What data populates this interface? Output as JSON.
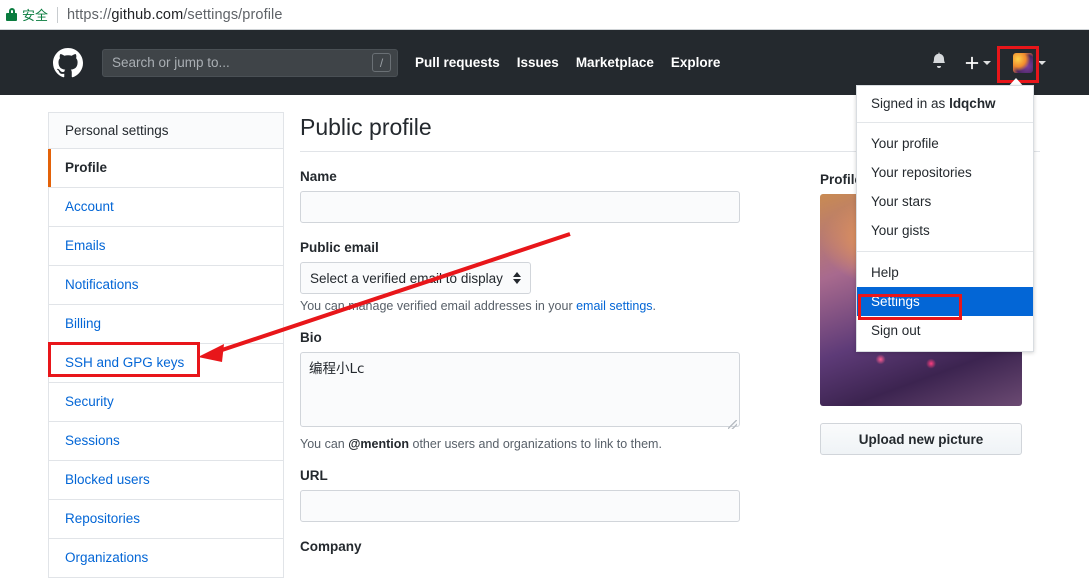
{
  "browser": {
    "secure_label": "安全",
    "url_scheme": "https://",
    "url_host": "github.com",
    "url_path": "/settings/profile"
  },
  "header": {
    "search_placeholder": "Search or jump to...",
    "search_shortcut": "/",
    "nav": [
      {
        "label": "Pull requests"
      },
      {
        "label": "Issues"
      },
      {
        "label": "Marketplace"
      },
      {
        "label": "Explore"
      }
    ]
  },
  "dropdown": {
    "signed_in_prefix": "Signed in as ",
    "username": "ldqchw",
    "group1": [
      {
        "label": "Your profile"
      },
      {
        "label": "Your repositories"
      },
      {
        "label": "Your stars"
      },
      {
        "label": "Your gists"
      }
    ],
    "group2": [
      {
        "label": "Help"
      },
      {
        "label": "Settings",
        "selected": true
      },
      {
        "label": "Sign out"
      }
    ]
  },
  "sidebar": {
    "heading": "Personal settings",
    "items": [
      {
        "label": "Profile",
        "active": true
      },
      {
        "label": "Account"
      },
      {
        "label": "Emails"
      },
      {
        "label": "Notifications"
      },
      {
        "label": "Billing"
      },
      {
        "label": "SSH and GPG keys"
      },
      {
        "label": "Security"
      },
      {
        "label": "Sessions"
      },
      {
        "label": "Blocked users"
      },
      {
        "label": "Repositories"
      },
      {
        "label": "Organizations"
      }
    ]
  },
  "main": {
    "title": "Public profile",
    "name_label": "Name",
    "name_value": "",
    "public_email_label": "Public email",
    "public_email_selected": "Select a verified email to display",
    "email_help_prefix": "You can manage verified email addresses in your ",
    "email_help_link": "email settings",
    "email_help_suffix": ".",
    "bio_label": "Bio",
    "bio_value": "编程小Lc",
    "bio_help_prefix": "You can ",
    "bio_help_mention": "@mention",
    "bio_help_suffix": " other users and organizations to link to them.",
    "url_label": "URL",
    "url_value": "",
    "company_label": "Company"
  },
  "profile_picture": {
    "label": "Profile picture",
    "upload_button": "Upload new picture"
  },
  "colors": {
    "header_bg": "#24292e",
    "accent_blue": "#0366d6",
    "annotation_red": "#e8161a",
    "active_orange": "#e36209",
    "secure_green": "#0a7c3f"
  }
}
